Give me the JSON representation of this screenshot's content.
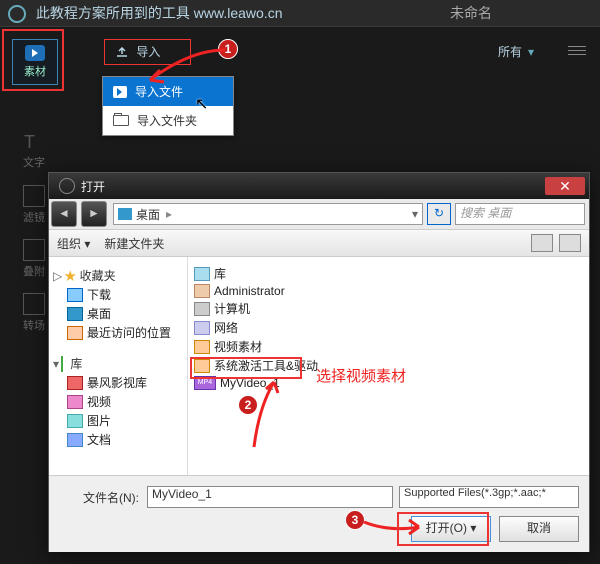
{
  "titlebar": {
    "text": "此教程方案所用到的工具 www.leawo.cn",
    "tab": "未命名"
  },
  "sidebar_tool": {
    "label": "素材"
  },
  "leftnav": [
    "文字",
    "滤镜",
    "叠附",
    "转场"
  ],
  "import_btn": "导入",
  "all_filter": "所有",
  "dropdown": {
    "file": "导入文件",
    "folder": "导入文件夹"
  },
  "dialog": {
    "title": "打开",
    "path_label": "桌面",
    "search_placeholder": "搜索 桌面",
    "toolbar": {
      "org": "组织",
      "newfolder": "新建文件夹"
    },
    "side": {
      "fav": "收藏夹",
      "dl": "下载",
      "dsk": "桌面",
      "rec": "最近访问的位置",
      "lib": "库",
      "bf": "暴风影视库",
      "vid": "视频",
      "pic": "图片",
      "doc": "文档"
    },
    "main": {
      "lib": "库",
      "admin": "Administrator",
      "pc": "计算机",
      "net": "网络",
      "folder1": "视频素材",
      "folder2": "系统激活工具&驱动",
      "file1": "MyVideo_1",
      "annotation": "选择视频素材"
    },
    "fname_label": "文件名(N):",
    "fname_value": "MyVideo_1",
    "filter": "Supported Files(*.3gp;*.aac;*",
    "open": "打开(O)",
    "cancel": "取消"
  }
}
